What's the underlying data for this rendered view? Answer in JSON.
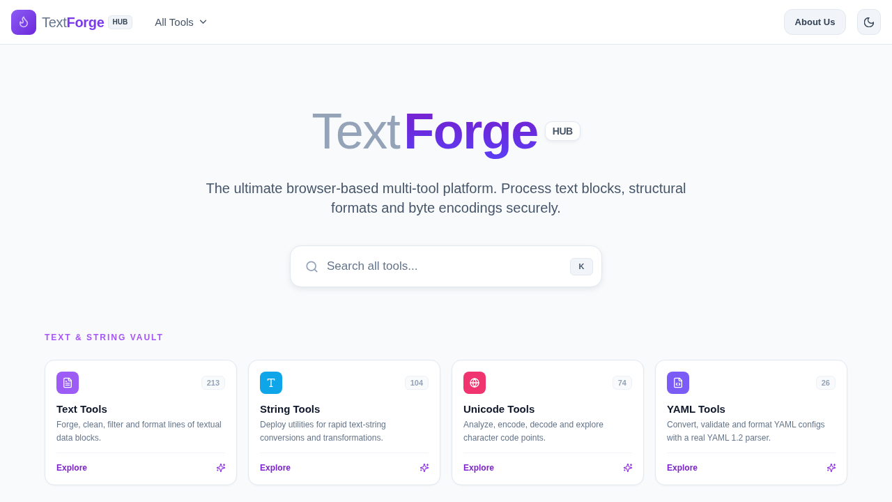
{
  "header": {
    "brand": {
      "light": "Text",
      "bold": "Forge",
      "badge": "HUB"
    },
    "nav_menu": {
      "label": "All Tools"
    },
    "about_button": "About Us"
  },
  "hero": {
    "title_light": "Text",
    "title_bold": "Forge",
    "badge": "HUB",
    "subtitle": "The ultimate browser-based multi-tool platform. Process text blocks, structural formats and byte encodings securely.",
    "search": {
      "placeholder": "Search all tools...",
      "shortcut": "K"
    }
  },
  "section": {
    "title": "TEXT & STRING VAULT",
    "cards": [
      {
        "title": "Text Tools",
        "description": "Forge, clean, filter and format lines of textual data blocks.",
        "count": "213",
        "link": "Explore",
        "color": "#9d5cf6"
      },
      {
        "title": "String Tools",
        "description": "Deploy utilities for rapid text-string conversions and transformations.",
        "count": "104",
        "link": "Explore",
        "color": "#0ea5e9"
      },
      {
        "title": "Unicode Tools",
        "description": "Analyze, encode, decode and explore character code points.",
        "count": "74",
        "link": "Explore",
        "color": "#f0346f"
      },
      {
        "title": "YAML Tools",
        "description": "Convert, validate and format YAML configs with a real YAML 1.2 parser.",
        "count": "26",
        "link": "Explore",
        "color": "#7c5cf6"
      }
    ]
  }
}
